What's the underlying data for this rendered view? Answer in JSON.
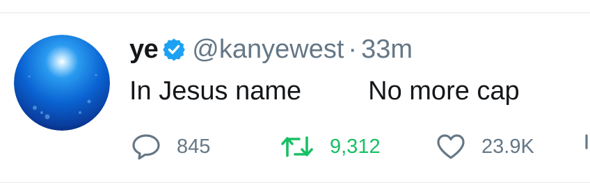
{
  "tweet": {
    "author": {
      "name": "ye",
      "handle": "@kanyewest",
      "verified": true,
      "avatar": "blue-globe-avatar"
    },
    "separator": "·",
    "time": "33m",
    "text_part1": "In Jesus name",
    "text_part2": "No more cap",
    "actions": {
      "reply": {
        "icon": "reply-icon",
        "count": "845"
      },
      "retweet": {
        "icon": "retweet-icon",
        "count": "9,312",
        "color": "#17bf63"
      },
      "like": {
        "icon": "heart-icon",
        "count": "23.9K"
      },
      "share": {
        "icon": "share-icon"
      }
    }
  },
  "colors": {
    "text_primary": "#14171a",
    "text_secondary": "#657786",
    "verified_blue": "#1da1f2",
    "retweet_green": "#17bf63",
    "divider": "#e3e8ec"
  }
}
